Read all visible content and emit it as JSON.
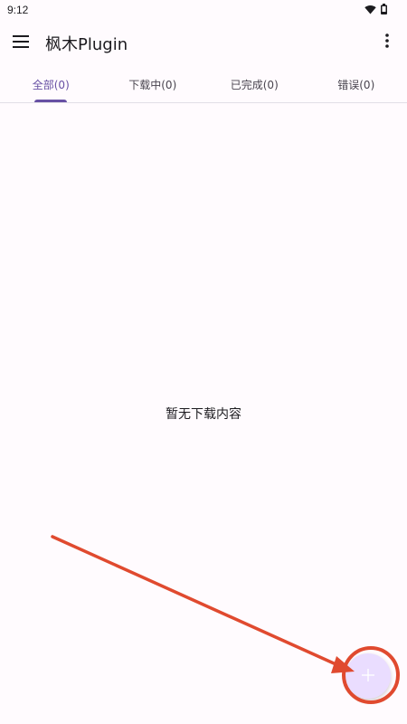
{
  "status_bar": {
    "time": "9:12",
    "icons": [
      "wifi-icon",
      "battery-icon"
    ]
  },
  "app_bar": {
    "title": "枫木Plugin",
    "menu_icon": "hamburger-menu-icon",
    "overflow_icon": "more-vert-icon"
  },
  "tabs": [
    {
      "label": "全部(0)",
      "active": true
    },
    {
      "label": "下载中(0)",
      "active": false
    },
    {
      "label": "已完成(0)",
      "active": false
    },
    {
      "label": "错误(0)",
      "active": false
    }
  ],
  "empty_state": {
    "message": "暂无下载内容"
  },
  "fab": {
    "icon": "plus-icon"
  },
  "annotation": {
    "type": "arrow-and-circle",
    "color": "#e04a2f",
    "target": "fab"
  },
  "colors": {
    "primary": "#6750a4",
    "background": "#fffbfe",
    "fab_container": "#eaddff",
    "annotation": "#e04a2f"
  }
}
